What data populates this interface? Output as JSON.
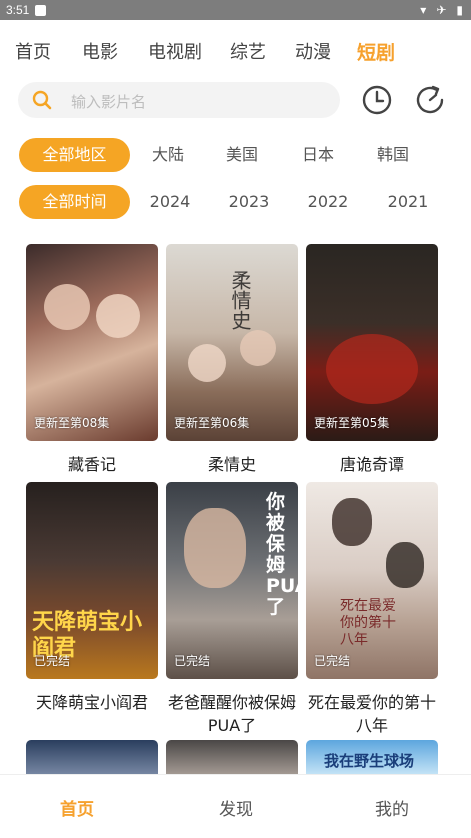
{
  "status_bar": {
    "time": "3:51"
  },
  "nav": {
    "tabs": [
      "首页",
      "电影",
      "电视剧",
      "综艺",
      "动漫",
      "短剧"
    ],
    "active": "短剧"
  },
  "search": {
    "placeholder": "输入影片名"
  },
  "filters": {
    "regions": [
      "全部地区",
      "大陆",
      "美国",
      "日本",
      "韩国"
    ],
    "years": [
      "全部时间",
      "2024",
      "2023",
      "2022",
      "2021"
    ]
  },
  "cards": [
    {
      "title": "藏香记",
      "status": "更新至第08集"
    },
    {
      "title": "柔情史",
      "status": "更新至第06集",
      "art": "柔情史"
    },
    {
      "title": "唐诡奇谭",
      "status": "更新至第05集"
    },
    {
      "title": "天降萌宝小阎君",
      "status": "已完结",
      "art": "天降萌宝小阎君"
    },
    {
      "title": "老爸醒醒你被保姆PUA了",
      "status": "已完结",
      "art": "你被保姆PUA了"
    },
    {
      "title": "死在最爱你的第十八年",
      "status": "已完结",
      "art": "死在最爱你的第十八年"
    }
  ],
  "partial_row": {
    "caption": "我在野生球场"
  },
  "bottom_nav": {
    "items": [
      "首页",
      "发现",
      "我的"
    ],
    "active": "首页"
  },
  "colors": {
    "accent": "#f5a524",
    "active_text": "#f6a12e"
  }
}
